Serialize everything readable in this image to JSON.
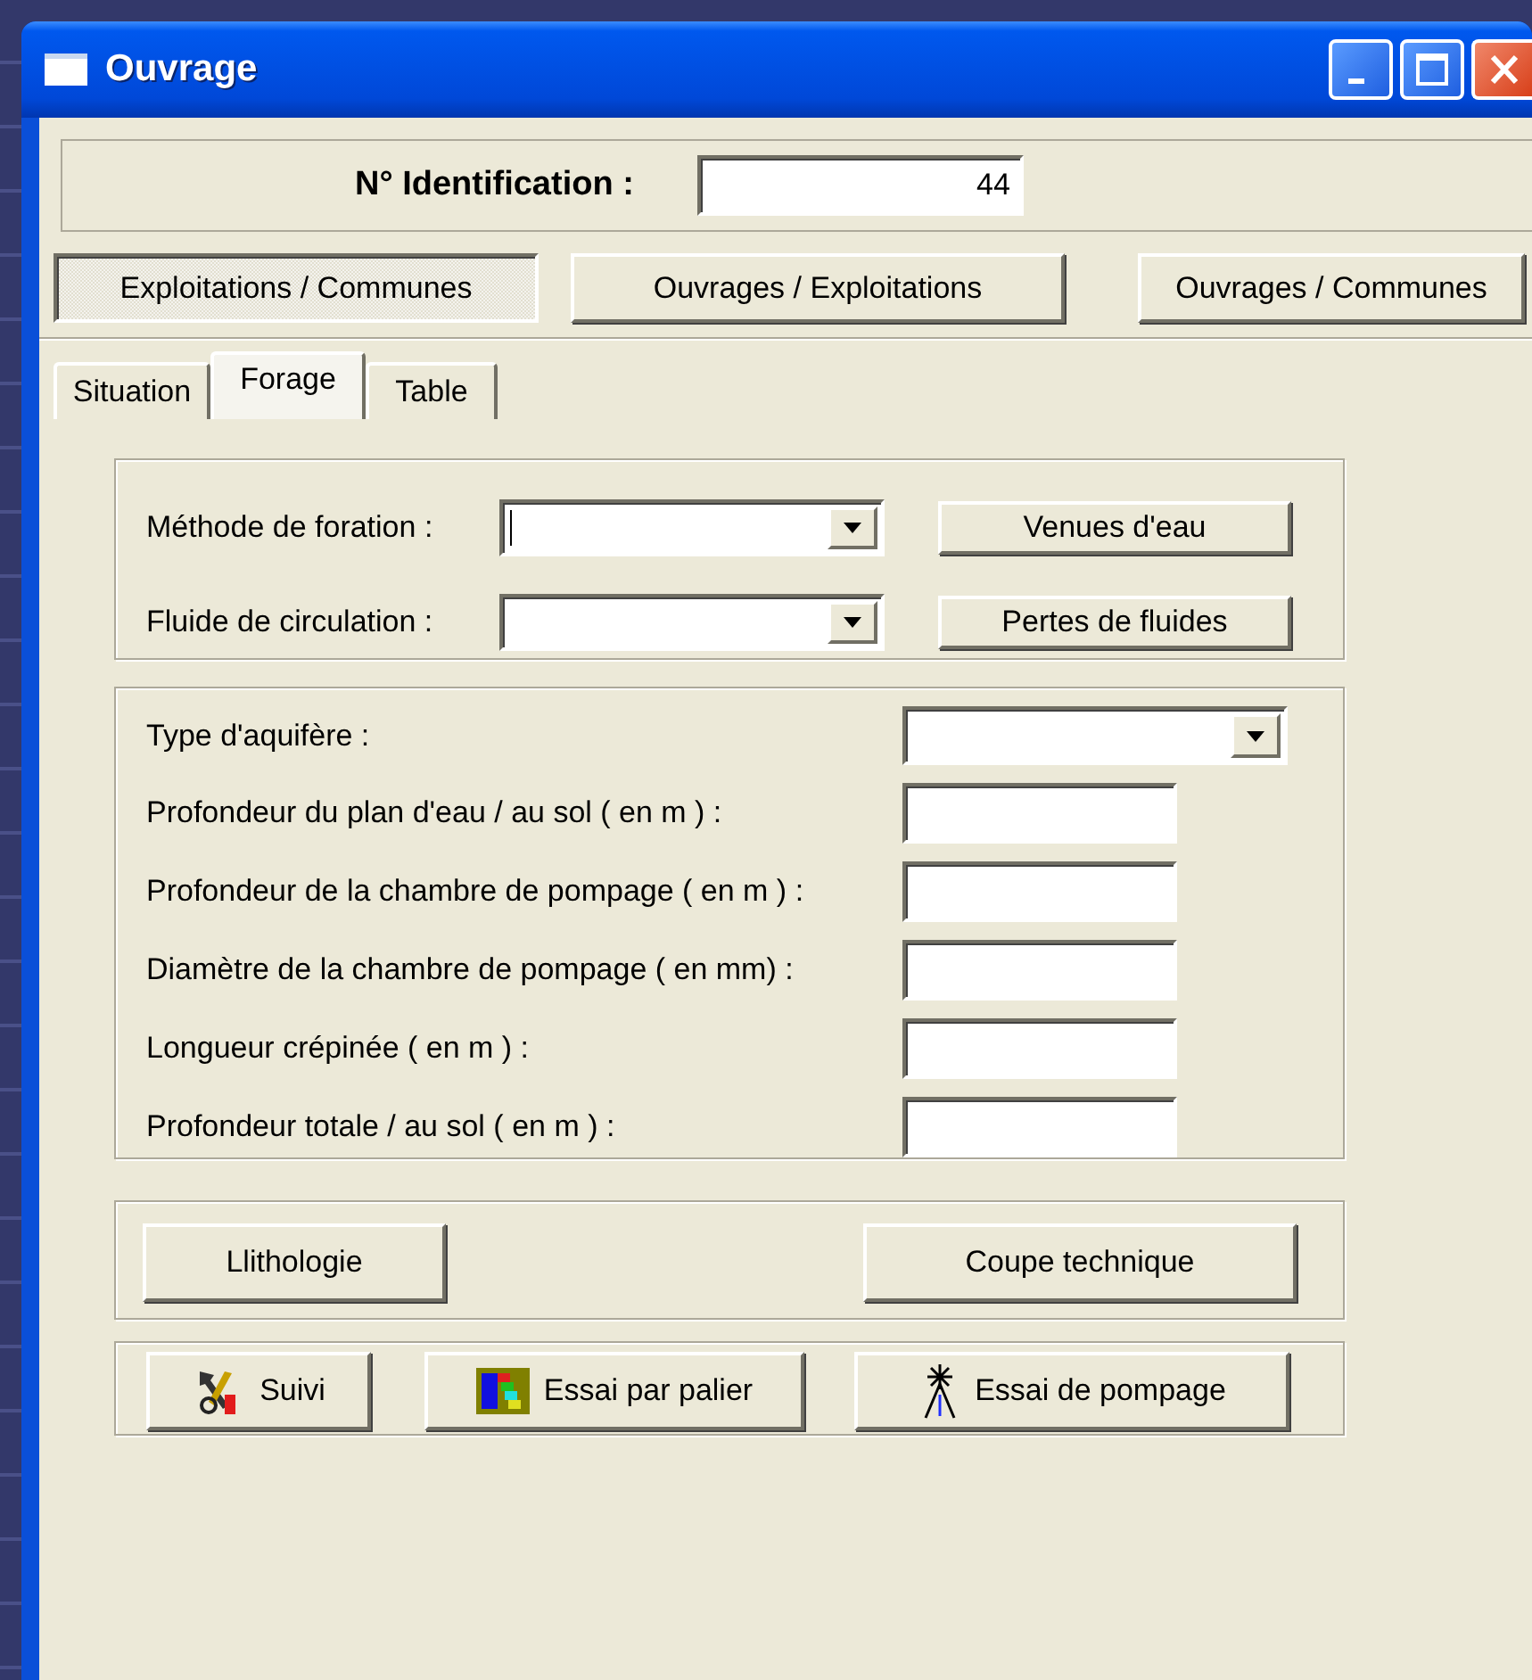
{
  "window": {
    "title": "Ouvrage"
  },
  "identification": {
    "label": "N° Identification :",
    "value": "44"
  },
  "nav_buttons": [
    {
      "label": "Exploitations / Communes",
      "selected": true
    },
    {
      "label": "Ouvrages / Exploitations",
      "selected": false
    },
    {
      "label": "Ouvrages / Communes",
      "selected": false
    }
  ],
  "tabs": [
    {
      "label": "Situation",
      "selected": false
    },
    {
      "label": "Forage",
      "selected": true
    },
    {
      "label": "Table",
      "selected": false
    }
  ],
  "drilling": {
    "fields": [
      {
        "label": "Méthode de foration :",
        "focused": true
      },
      {
        "label": "Fluide de circulation :",
        "focused": false
      }
    ],
    "buttons": [
      "Venues d'eau",
      "Pertes de fluides"
    ]
  },
  "aquifer": {
    "fields": [
      {
        "label": "Type d'aquifère :",
        "kind": "combo"
      },
      {
        "label": "Profondeur du plan d'eau / au sol ( en m ) :",
        "kind": "text"
      },
      {
        "label": "Profondeur de la chambre de pompage ( en m ) :",
        "kind": "text"
      },
      {
        "label": "Diamètre de la chambre de pompage ( en mm) :",
        "kind": "text"
      },
      {
        "label": "Longueur crépinée ( en m ) :",
        "kind": "text"
      },
      {
        "label": "Profondeur totale / au sol ( en m ) :",
        "kind": "text"
      }
    ]
  },
  "section_buttons": [
    "Llithologie",
    "Coupe technique"
  ],
  "test_buttons": [
    "Suivi",
    "Essai par palier",
    "Essai de pompage"
  ]
}
